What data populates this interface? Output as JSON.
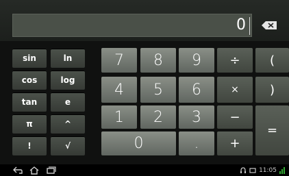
{
  "display": {
    "value": "0"
  },
  "functions": [
    "sin",
    "ln",
    "cos",
    "log",
    "tan",
    "e",
    "π",
    "^",
    "!",
    "√"
  ],
  "digits": {
    "row1": [
      "7",
      "8",
      "9"
    ],
    "row2": [
      "4",
      "5",
      "6"
    ],
    "row3": [
      "1",
      "2",
      "3"
    ],
    "zero": "0",
    "dot": "."
  },
  "operators": {
    "divide": "÷",
    "open_paren": "(",
    "multiply": "×",
    "close_paren": ")",
    "minus": "−",
    "plus": "+",
    "equals": "="
  },
  "nav": {
    "back": "back-icon",
    "home": "home-icon",
    "recent": "recent-apps-icon"
  },
  "status": {
    "icons": [
      "headset-icon",
      "notification-icon"
    ],
    "time_text": "11:05"
  }
}
